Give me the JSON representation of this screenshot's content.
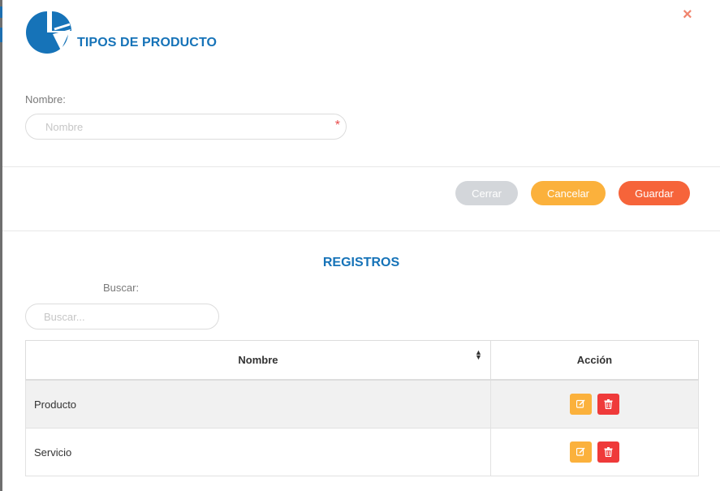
{
  "modal": {
    "title": "TIPOS DE PRODUCTO",
    "close_symbol": "×",
    "logo_icon": "pie-chart-logo-icon",
    "accent_color": "#1673b8"
  },
  "form": {
    "nombre_label": "Nombre:",
    "nombre_placeholder": "Nombre",
    "nombre_value": "",
    "required_mark": "*"
  },
  "buttons": {
    "cerrar": "Cerrar",
    "cancelar": "Cancelar",
    "guardar": "Guardar"
  },
  "records": {
    "heading": "REGISTROS",
    "search_label": "Buscar:",
    "search_placeholder": "Buscar...",
    "columns": [
      "Nombre",
      "Acción"
    ],
    "sort_icon": "sort-icon",
    "rows": [
      {
        "nombre": "Producto",
        "actions": [
          "edit-icon",
          "trash-icon"
        ]
      },
      {
        "nombre": "Servicio",
        "actions": [
          "edit-icon",
          "trash-icon"
        ]
      }
    ]
  }
}
